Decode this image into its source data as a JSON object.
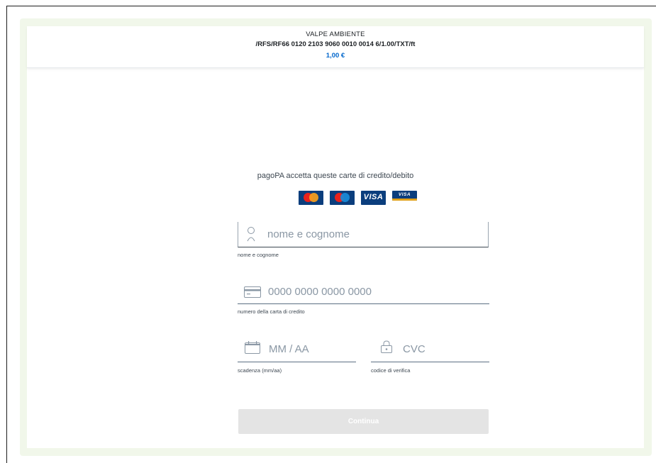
{
  "header": {
    "merchant": "VALPE AMBIENTE",
    "subject": "/RFS/RF66 0120 2103 9060 0010 0014 6/1.00/TXT/ft",
    "amount": "1,00 €"
  },
  "accepts_text": "pagoPA accetta queste carte di credito/debito",
  "card_brands": [
    {
      "name": "mastercard-logo"
    },
    {
      "name": "maestro-logo"
    },
    {
      "name": "visa-logo",
      "text": "VISA"
    },
    {
      "name": "visa-electron-logo",
      "text": "VISA"
    }
  ],
  "form": {
    "name": {
      "placeholder": "nome e cognome",
      "label": "nome e cognome",
      "icon": "user-icon"
    },
    "card_number": {
      "placeholder": "0000 0000 0000 0000",
      "label": "numero della carta di credito",
      "icon": "credit-card-icon"
    },
    "expiry": {
      "placeholder": "MM / AA",
      "label": "scadenza (mm/aa)",
      "icon": "calendar-icon"
    },
    "cvc": {
      "placeholder": "CVC",
      "label": "codice di verifica",
      "icon": "lock-icon"
    }
  },
  "submit": {
    "label": "Continua",
    "disabled": true
  },
  "colors": {
    "accent": "#0066cc",
    "button_disabled": "#e4e4e4",
    "glow": "#f1f7ea"
  }
}
